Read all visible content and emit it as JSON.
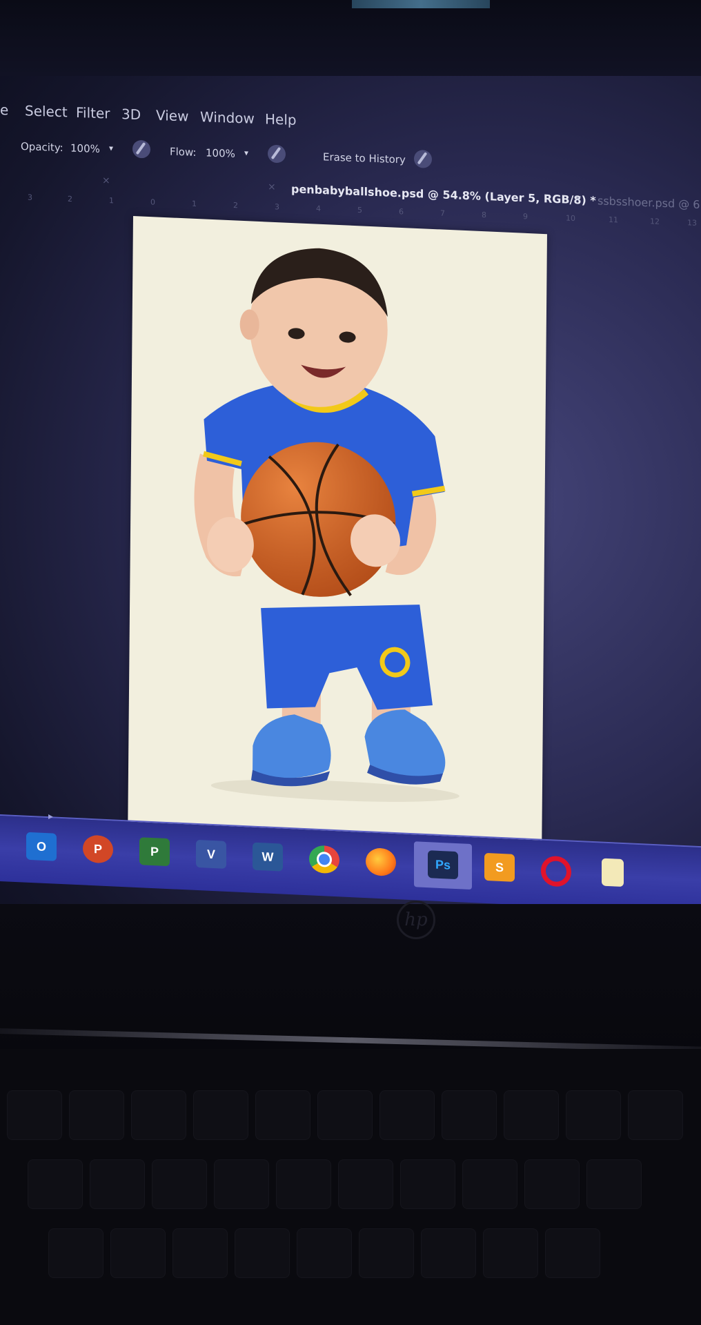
{
  "menu": {
    "items": [
      "Select",
      "Filter",
      "3D",
      "View",
      "Window",
      "Help"
    ]
  },
  "options_bar": {
    "opacity_label": "Opacity:",
    "opacity_value": "100%",
    "flow_label": "Flow:",
    "flow_value": "100%",
    "erase_to_history": "Erase to History"
  },
  "tabs": {
    "active_title": "penbabyballshoe.psd @ 54.8% (Layer 5, RGB/8) *",
    "right_title": "ssbsshoer.psd @ 6"
  },
  "ruler": {
    "ticks": [
      "3",
      "2",
      "1",
      "0",
      "1",
      "2",
      "3",
      "4",
      "5",
      "6",
      "7",
      "8",
      "9",
      "10",
      "11",
      "12",
      "13"
    ]
  },
  "taskbar": {
    "apps": [
      {
        "name": "outlook",
        "letter": "O",
        "color": "#1f6fd1"
      },
      {
        "name": "powerpoint",
        "letter": "P",
        "color": "#d24726"
      },
      {
        "name": "project",
        "letter": "P",
        "color": "#2f7a3a"
      },
      {
        "name": "visio",
        "letter": "V",
        "color": "#3955a3"
      },
      {
        "name": "word",
        "letter": "W",
        "color": "#2b5797"
      },
      {
        "name": "chrome",
        "letter": "",
        "color": "#e8453c"
      },
      {
        "name": "firefox",
        "letter": "",
        "color": "#e66000"
      },
      {
        "name": "photoshop",
        "letter": "Ps",
        "color": "#1b2a52"
      },
      {
        "name": "sublime",
        "letter": "S",
        "color": "#f29b20"
      },
      {
        "name": "opera",
        "letter": "O",
        "color": "#e0132b"
      },
      {
        "name": "file",
        "letter": "",
        "color": "#f3e9b8"
      }
    ]
  },
  "laptop": {
    "brand": "hp"
  },
  "colors": {
    "canvas_bg": "#f2efde",
    "jersey": "#2d5fd8",
    "jersey_trim": "#f2c919",
    "ball": "#d9621f",
    "shoe": "#4a87e0"
  }
}
